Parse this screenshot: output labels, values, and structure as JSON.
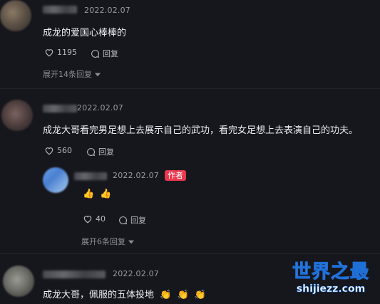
{
  "comments": [
    {
      "date": "2022.02.07",
      "text": "成龙的爱国心棒棒的",
      "likes": "1195",
      "reply_label": "回复",
      "expand_label": "展开14条回复"
    },
    {
      "date": "2022.02.07",
      "text": "成龙大哥看完男足想上去展示自己的武功，看完女足想上去表演自己的功夫。",
      "likes": "560",
      "reply_label": "回复",
      "reply": {
        "date": "2022.02.07",
        "author_badge": "作者",
        "emojis": [
          "👍",
          "👍"
        ],
        "likes": "40",
        "reply_label": "回复",
        "expand_label": "展开6条回复"
      }
    },
    {
      "date": "2022.02.07",
      "text": "成龙大哥，佩服的五体投地",
      "emojis": [
        "👏",
        "👏",
        "👏"
      ]
    }
  ],
  "watermark": {
    "title": "世界之最",
    "subtitle": "shijiezz.com"
  },
  "icons": {
    "like": "heart-icon",
    "reply": "comment-bubble-icon",
    "expand": "chevron-down-icon"
  }
}
